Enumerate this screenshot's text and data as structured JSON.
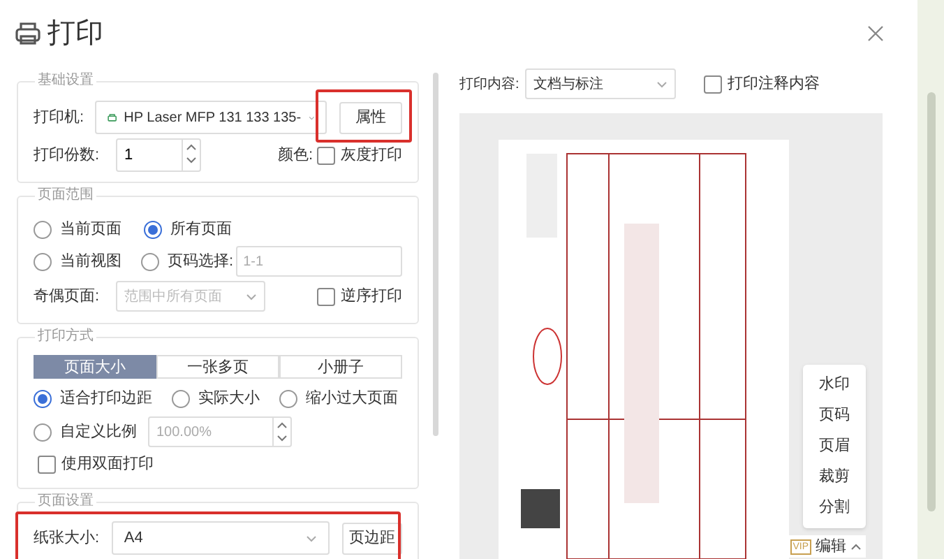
{
  "dialog": {
    "title": "打印"
  },
  "basic_settings": {
    "legend": "基础设置",
    "printer_label": "打印机:",
    "printer": "HP Laser MFP 131 133 135-",
    "properties_button": "属性",
    "copies_label": "打印份数:",
    "copies": "1",
    "color_label": "颜色:",
    "grayscale": {
      "label": "灰度打印",
      "checked": false
    }
  },
  "page_range": {
    "legend": "页面范围",
    "options": [
      {
        "label": "当前页面",
        "selected": false
      },
      {
        "label": "所有页面",
        "selected": true
      },
      {
        "label": "当前视图",
        "selected": false
      },
      {
        "label": "页码选择:",
        "selected": false
      }
    ],
    "page_numbers": "1-1",
    "odd_even_label": "奇偶页面:",
    "odd_even": "范围中所有页面",
    "reverse": {
      "label": "逆序打印",
      "checked": false
    }
  },
  "print_mode": {
    "legend": "打印方式",
    "tabs": [
      {
        "label": "页面大小",
        "selected": true
      },
      {
        "label": "一张多页",
        "selected": false
      },
      {
        "label": "小册子",
        "selected": false
      }
    ],
    "scale_options": [
      {
        "label": "适合打印边距",
        "selected": true
      },
      {
        "label": "实际大小",
        "selected": false
      },
      {
        "label": "缩小过大页面",
        "selected": false
      },
      {
        "label": "自定义比例",
        "selected": false
      }
    ],
    "custom_scale": "100.00%",
    "duplex": {
      "label": "使用双面打印",
      "checked": false
    }
  },
  "page_setup": {
    "legend": "页面设置",
    "paper_label": "纸张大小:",
    "paper": "A4",
    "margins_button": "页边距"
  },
  "preview": {
    "content_label": "打印内容:",
    "content": "文档与标注",
    "annotations": {
      "label": "打印注释内容",
      "checked": false
    },
    "menu": [
      "水印",
      "页码",
      "页眉",
      "裁剪",
      "分割"
    ],
    "vip_badge": "VIP",
    "edit_button": "编辑"
  }
}
